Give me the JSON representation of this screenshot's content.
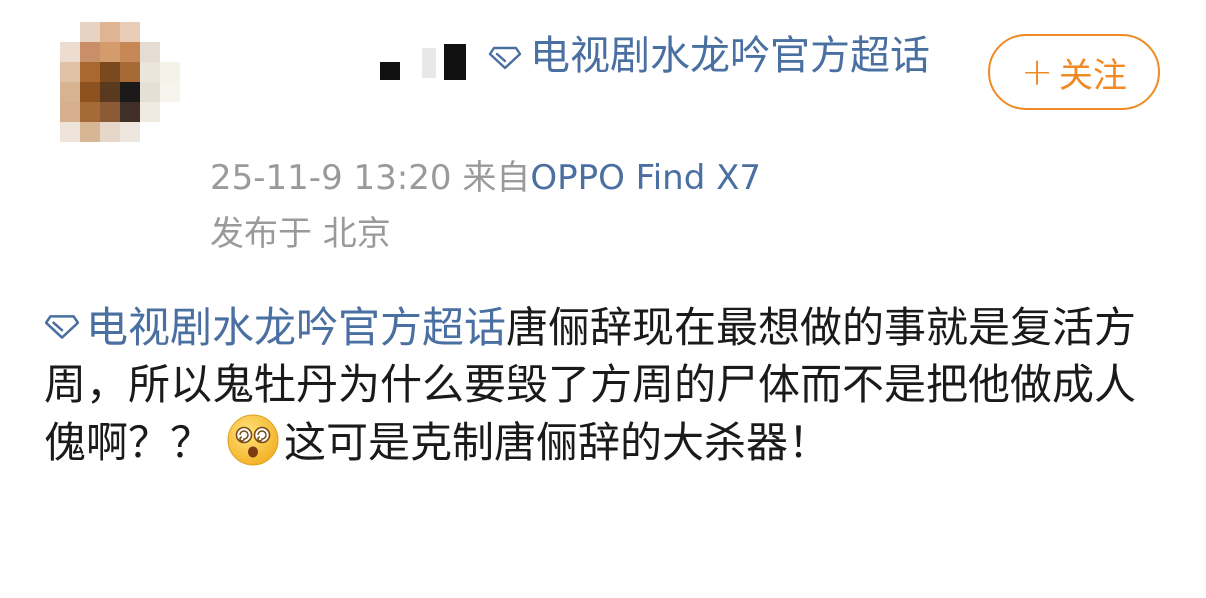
{
  "post": {
    "topic_header": "电视剧水龙吟官方超话",
    "follow_button": {
      "label": "关注",
      "icon": "plus-icon"
    },
    "meta": {
      "time": "25-11-9 13:20",
      "source_prefix": "来自",
      "source_device": "OPPO Find X7",
      "location": "发布于 北京"
    },
    "body": {
      "topic_link": "电视剧水龙吟官方超话",
      "text_before_emoji": "唐俪辞现在最想做的事就是复活方周，所以鬼牡丹为什么要毁了方周的尸体而不是把他做成人傀啊？？",
      "emoji": "dizzy-face-emoji",
      "text_after_emoji": "这可是克制唐俪辞的大杀器！"
    },
    "colors": {
      "link_blue": "#4a6fa1",
      "follow_orange": "#f08a24",
      "meta_gray": "#9a9a9a",
      "body_text": "#1a1a1a"
    },
    "icons": {
      "topic": "super-topic-diamond-icon",
      "avatar": "pixelated-user-avatar"
    }
  }
}
